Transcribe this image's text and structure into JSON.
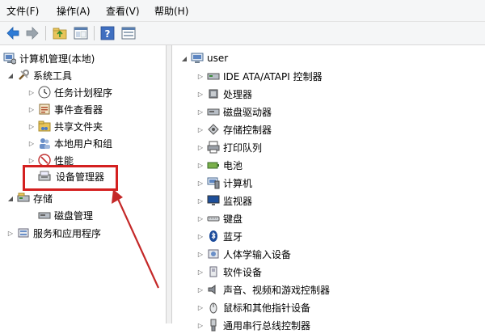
{
  "menu": {
    "file": "文件(F)",
    "action": "操作(A)",
    "view": "查看(V)",
    "help": "帮助(H)"
  },
  "toolbar": {
    "buttons": [
      "back-icon",
      "forward-icon",
      "up-folder-icon",
      "show-hide-tree-icon",
      "help-icon",
      "properties-icon"
    ]
  },
  "tree": {
    "root": "计算机管理(本地)",
    "system_tools": "系统工具",
    "task_scheduler": "任务计划程序",
    "event_viewer": "事件查看器",
    "shared_folders": "共享文件夹",
    "local_users": "本地用户和组",
    "performance": "性能",
    "device_manager": "设备管理器",
    "storage": "存储",
    "disk_management": "磁盘管理",
    "services_apps": "服务和应用程序"
  },
  "devices": {
    "root": "user",
    "items": [
      "IDE ATA/ATAPI 控制器",
      "处理器",
      "磁盘驱动器",
      "存储控制器",
      "打印队列",
      "电池",
      "计算机",
      "监视器",
      "键盘",
      "蓝牙",
      "人体学输入设备",
      "软件设备",
      "声音、视频和游戏控制器",
      "鼠标和其他指针设备",
      "通用串行总线控制器"
    ]
  },
  "colors": {
    "highlight_box": "#d42020",
    "arrow": "#c42828"
  }
}
